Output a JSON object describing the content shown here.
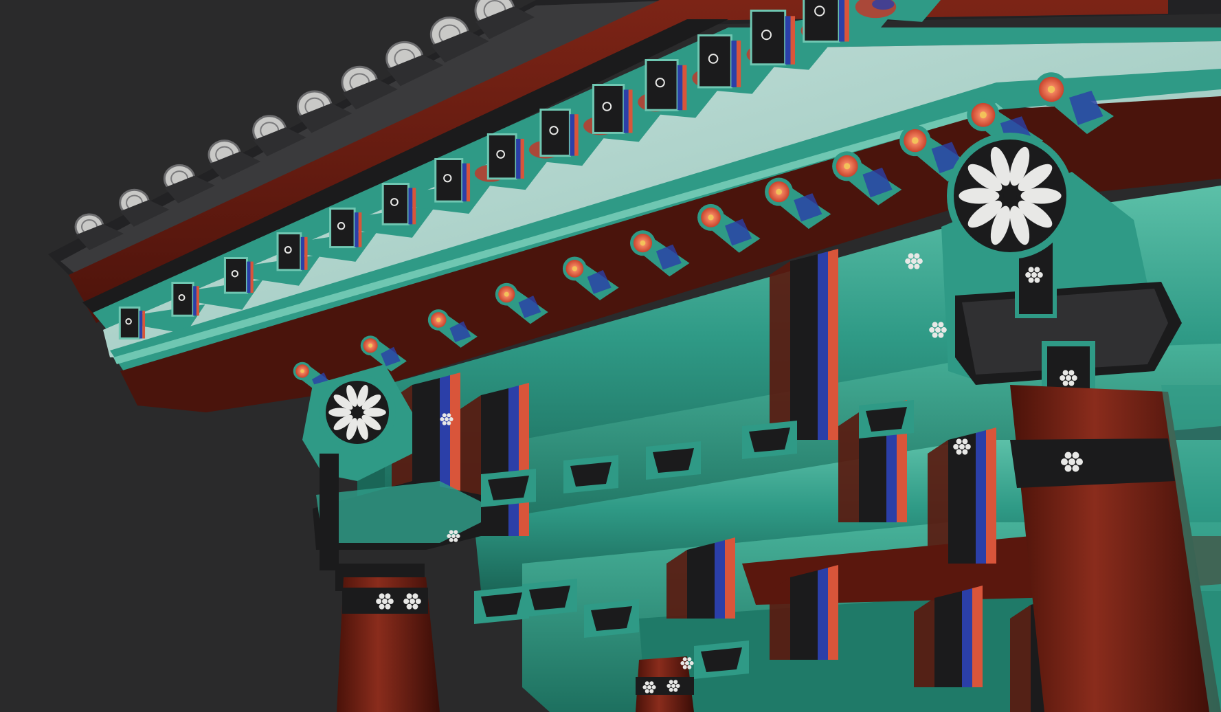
{
  "scene": {
    "subject": "dancheong-pavilion-eaves",
    "colors": {
      "background": "#2a2a2b",
      "teal": "#2f9a86",
      "teal_light": "#6fc7b2",
      "teal_dark": "#17584d",
      "red_wood": "#6a1e14",
      "red_wood_light": "#8e2e1f",
      "black": "#1b1b1c",
      "roof_tile": "#3d3d3f",
      "white": "#e8e8e6",
      "blue": "#2b3fa8",
      "orange": "#d9553a",
      "flower": "#e2765a",
      "flower_center": "#f3c15a"
    },
    "rafter_count": 14,
    "column_count": 3,
    "roof_tile_count": 10
  }
}
